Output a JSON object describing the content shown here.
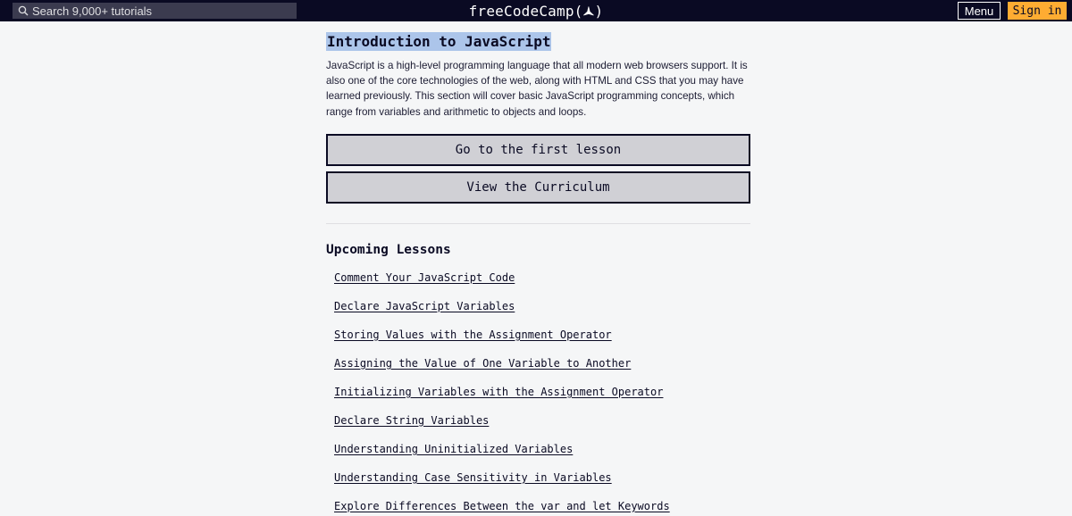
{
  "nav": {
    "search_placeholder": "Search 9,000+ tutorials",
    "logo_text": "freeCodeCamp(",
    "logo_flame": "🔥",
    "logo_close": ")",
    "menu_label": "Menu",
    "signin_label": "Sign in"
  },
  "main": {
    "title": "Introduction to JavaScript",
    "intro": "JavaScript is a high-level programming language that all modern web browsers support. It is also one of the core technologies of the web, along with HTML and CSS that you may have learned previously. This section will cover basic JavaScript programming concepts, which range from variables and arithmetic to objects and loops.",
    "first_lesson_label": "Go to the first lesson",
    "curriculum_label": "View the Curriculum",
    "upcoming_heading": "Upcoming Lessons",
    "lessons": [
      "Comment Your JavaScript Code",
      "Declare JavaScript Variables",
      "Storing Values with the Assignment Operator",
      "Assigning the Value of One Variable to Another",
      "Initializing Variables with the Assignment Operator",
      "Declare String Variables",
      "Understanding Uninitialized Variables",
      "Understanding Case Sensitivity in Variables",
      "Explore Differences Between the var and let Keywords"
    ]
  },
  "colors": {
    "nav_bg": "#0a0a23",
    "page_bg": "#f5f6f7",
    "title_highlight": "#acc5ea",
    "signin_bg": "#feac32",
    "button_bg": "#d0d0d5"
  },
  "icons": {
    "search": "search-icon",
    "logo": "fcc-flame-icon"
  }
}
